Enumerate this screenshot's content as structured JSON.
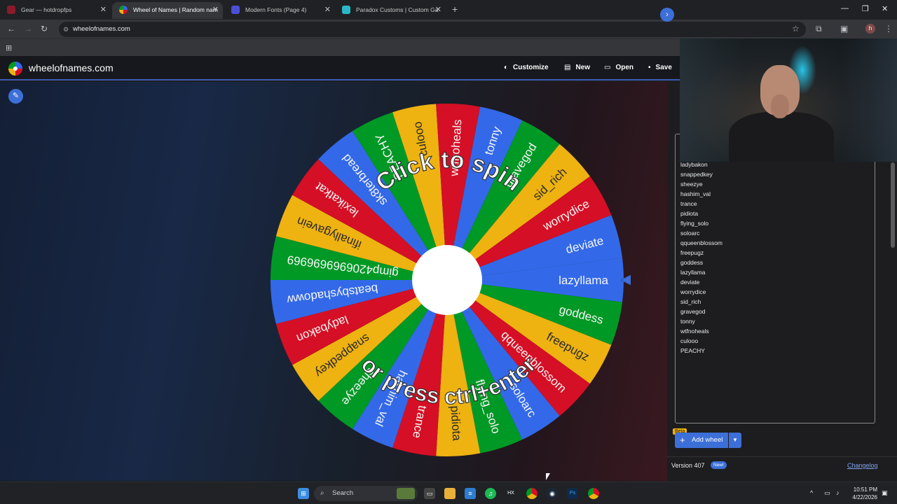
{
  "browser": {
    "tabs": [
      {
        "title": "Gear — hotdropfps"
      },
      {
        "title": "Wheel of Names | Random nam"
      },
      {
        "title": "Modern Fonts (Page 4)"
      },
      {
        "title": "Paradox Customs | Custom Ga"
      }
    ],
    "url": "wheelofnames.com",
    "profile_initial": "h"
  },
  "site": {
    "name": "wheelofnames.com",
    "buttons": {
      "customize": "Customize",
      "new": "New",
      "open": "Open",
      "save": "Save"
    }
  },
  "wheel": {
    "top_text": "Click to spin",
    "bottom_text": "or press ctrl+enter",
    "colors": [
      "#3369e8",
      "#009925",
      "#eeb211",
      "#d50f25"
    ],
    "pointer_color": "#3c6fd8",
    "winner_label": "lazyllama",
    "segments": [
      "lazyllama",
      "goddess",
      "freepugz",
      "qqueenblossom",
      "soloarc",
      "flying_solo",
      "pidiota",
      "trance",
      "hashim_val",
      "sheezye",
      "snappedkey",
      "ladybakon",
      "beatsbyshadoww",
      "gimp4206969696969",
      "ifinallygavein",
      "lexikatkat",
      "sk8terbread",
      "PEACHY",
      "culooo",
      "wtfnoheals",
      "tonny",
      "gravegod",
      "sid_rich",
      "worrydice",
      "deviate"
    ]
  },
  "entries": [
    "ifinallygavein",
    "gimp4206969696969",
    "beatsbyshadoww",
    "ladybakon",
    "snappedkey",
    "sheezye",
    "hashim_val",
    "trance",
    "pidiota",
    "flying_solo",
    "soloarc",
    "qqueenblossom",
    "freepugz",
    "goddess",
    "lazyllama",
    "deviate",
    "worrydice",
    "sid_rich",
    "gravegod",
    "tonny",
    "wtfnoheals",
    "culooo",
    "PEACHY"
  ],
  "panel": {
    "beta_label": "Beta",
    "add_wheel": "Add wheel",
    "version": "Version 407",
    "new_badge": "New!",
    "changelog": "Changelog"
  },
  "taskbar": {
    "search": "Search",
    "time": "10:51 PM",
    "date": "4/22/2026"
  }
}
